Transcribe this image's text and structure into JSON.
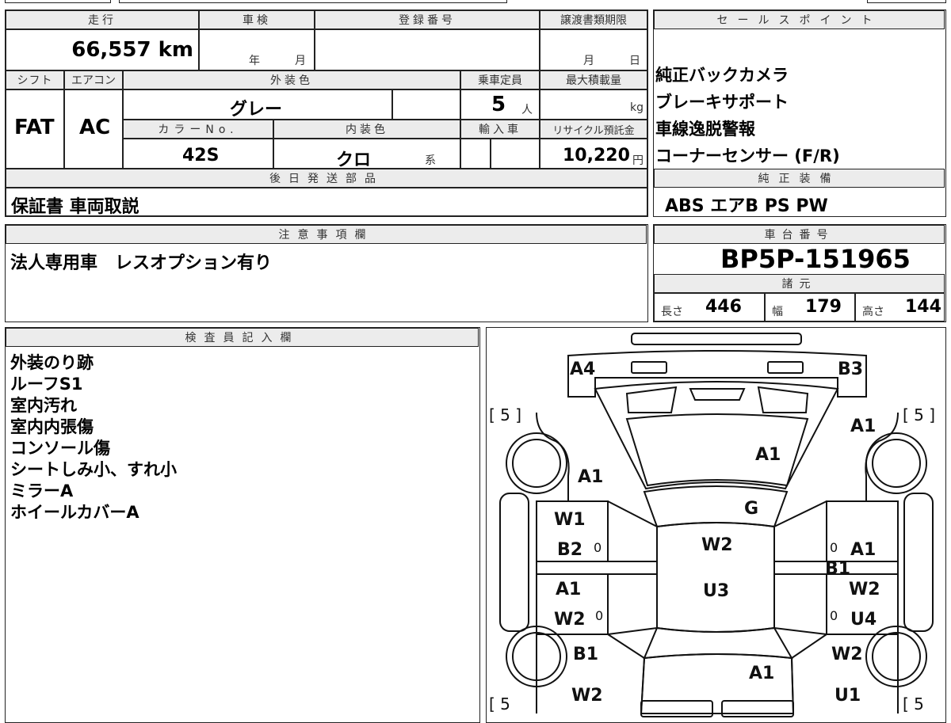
{
  "vehicle": {
    "mileage_label": "走行",
    "mileage_value": "66,557 km",
    "shaken_label": "車検",
    "shaken_year": "年",
    "shaken_month": "月",
    "registration_label": "登録番号",
    "transfer_label": "譲渡書類期限",
    "transfer_month": "月",
    "transfer_day": "日",
    "shift_label": "シフト",
    "shift_value": "FAT",
    "aircon_label": "エアコン",
    "aircon_value": "AC",
    "exterior_label": "外装色",
    "exterior_value": "グレー",
    "capacity_label": "乗車定員",
    "capacity_value": "5",
    "capacity_unit": "人",
    "maxload_label": "最大積載量",
    "maxload_unit": "kg",
    "colorno_label": "カラーNo.",
    "colorno_value": "42S",
    "interior_label": "内装色",
    "interior_value": "クロ",
    "interior_suffix": "系",
    "import_label": "輸入車",
    "recycle_label": "リサイクル預託金",
    "recycle_value": "10,220",
    "recycle_unit": "円"
  },
  "later_parts": {
    "label": "後日発送部品",
    "value": "保証書 車両取説"
  },
  "sales_points": {
    "label": "セールスポイント",
    "items": [
      "純正バックカメラ",
      "ブレーキサポート",
      "車線逸脱警報",
      "コーナーセンサー (F/R)"
    ]
  },
  "equipment": {
    "label": "純正装備",
    "value": "ABS エアB PS PW"
  },
  "notes": {
    "label": "注意事項欄",
    "value": "法人専用車　レスオプション有り"
  },
  "chassis": {
    "label": "車台番号",
    "value": "BP5P-151965"
  },
  "specs": {
    "label": "諸元",
    "length_label": "長さ",
    "length_value": "446",
    "width_label": "幅",
    "width_value": "179",
    "height_label": "高さ",
    "height_value": "144"
  },
  "inspector": {
    "label": "検査員記入欄",
    "lines": [
      "外装のり跡",
      "ルーフS1",
      "室内汚れ",
      "室内内張傷",
      "コンソール傷",
      "シートしみ小、すれ小",
      "ミラーA",
      "ホイールカバーA"
    ]
  },
  "diagram": {
    "tire_left_top": "[ 5 ]",
    "tire_right_top": "[ 5 ]",
    "tire_left_bottom": "[ 5",
    "tire_right_bottom": "[ 5",
    "codes": {
      "front_left_corner": "A4",
      "front_right_corner": "B3",
      "right_front_fender": "A1",
      "hood": "A1",
      "left_front_fender": "A1",
      "windshield": "G",
      "left_front_door_1": "W1",
      "left_front_door_2": "B2",
      "left_front_door_3": "0",
      "roof": "W2",
      "right_front_door_1": "0",
      "right_front_door_2": "A1",
      "right_pillar": "B1",
      "left_rear_door_1": "A1",
      "left_rear_door_2": "W2",
      "left_rear_door_3": "0",
      "roof_rear": "U3",
      "right_rear_door_1": "W2",
      "right_rear_door_2": "0",
      "right_rear_door_3": "U4",
      "left_rear_fender_1": "B1",
      "left_rear_fender_2": "W2",
      "trunk": "A1",
      "right_rear_fender_1": "W2",
      "right_rear_fender_2": "U1"
    }
  }
}
